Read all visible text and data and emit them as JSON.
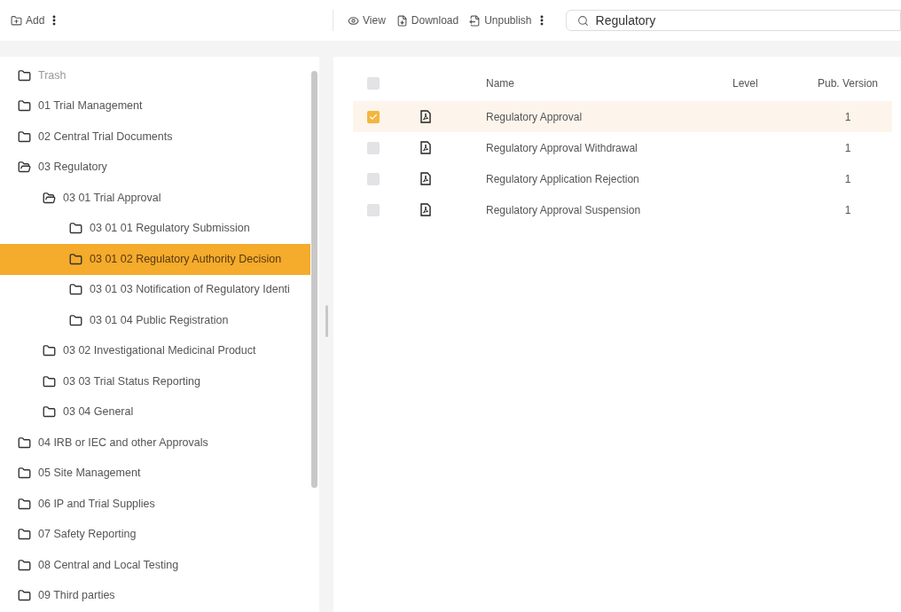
{
  "toolbar_left": {
    "add_label": "Add"
  },
  "toolbar_right": {
    "actions": [
      {
        "kind": "view",
        "label": "View"
      },
      {
        "kind": "download",
        "label": "Download"
      },
      {
        "kind": "unpublish",
        "label": "Unpublish"
      }
    ],
    "search": {
      "value": "Regulatory"
    }
  },
  "tree": [
    {
      "label": "Trash",
      "expanded": false,
      "selected": false,
      "dim": true
    },
    {
      "label": "01 Trial Management",
      "expanded": false,
      "selected": false
    },
    {
      "label": "02 Central Trial Documents",
      "expanded": false,
      "selected": false
    },
    {
      "label": "03 Regulatory",
      "expanded": true,
      "selected": false,
      "children": [
        {
          "label": "03 01 Trial Approval",
          "expanded": true,
          "selected": false,
          "children": [
            {
              "label": "03 01 01 Regulatory Submission",
              "expanded": false,
              "selected": false
            },
            {
              "label": "03 01 02 Regulatory Authority Decision",
              "expanded": false,
              "selected": true
            },
            {
              "label": "03 01 03 Notification of Regulatory Identi",
              "expanded": false,
              "selected": false
            },
            {
              "label": "03 01 04 Public Registration",
              "expanded": false,
              "selected": false
            }
          ]
        },
        {
          "label": "03 02 Investigational Medicinal Product",
          "expanded": false,
          "selected": false
        },
        {
          "label": "03 03 Trial Status Reporting",
          "expanded": false,
          "selected": false
        },
        {
          "label": "03 04 General",
          "expanded": false,
          "selected": false
        }
      ]
    },
    {
      "label": "04 IRB or IEC and other Approvals",
      "expanded": false,
      "selected": false
    },
    {
      "label": "05 Site Management",
      "expanded": false,
      "selected": false
    },
    {
      "label": "06 IP and Trial Supplies",
      "expanded": false,
      "selected": false
    },
    {
      "label": "07 Safety Reporting",
      "expanded": false,
      "selected": false
    },
    {
      "label": "08 Central and Local Testing",
      "expanded": false,
      "selected": false
    },
    {
      "label": "09 Third parties",
      "expanded": false,
      "selected": false
    }
  ],
  "table": {
    "all_checked": false,
    "columns": [
      "Name",
      "Level",
      "Pub. Version"
    ],
    "rows": [
      {
        "name": "Regulatory Approval",
        "pub_version": "1",
        "selected": true
      },
      {
        "name": "Regulatory Approval Withdrawal",
        "pub_version": "1",
        "selected": false
      },
      {
        "name": "Regulatory Application Rejection",
        "pub_version": "1",
        "selected": false
      },
      {
        "name": "Regulatory Approval Suspension",
        "pub_version": "1",
        "selected": false
      }
    ]
  }
}
